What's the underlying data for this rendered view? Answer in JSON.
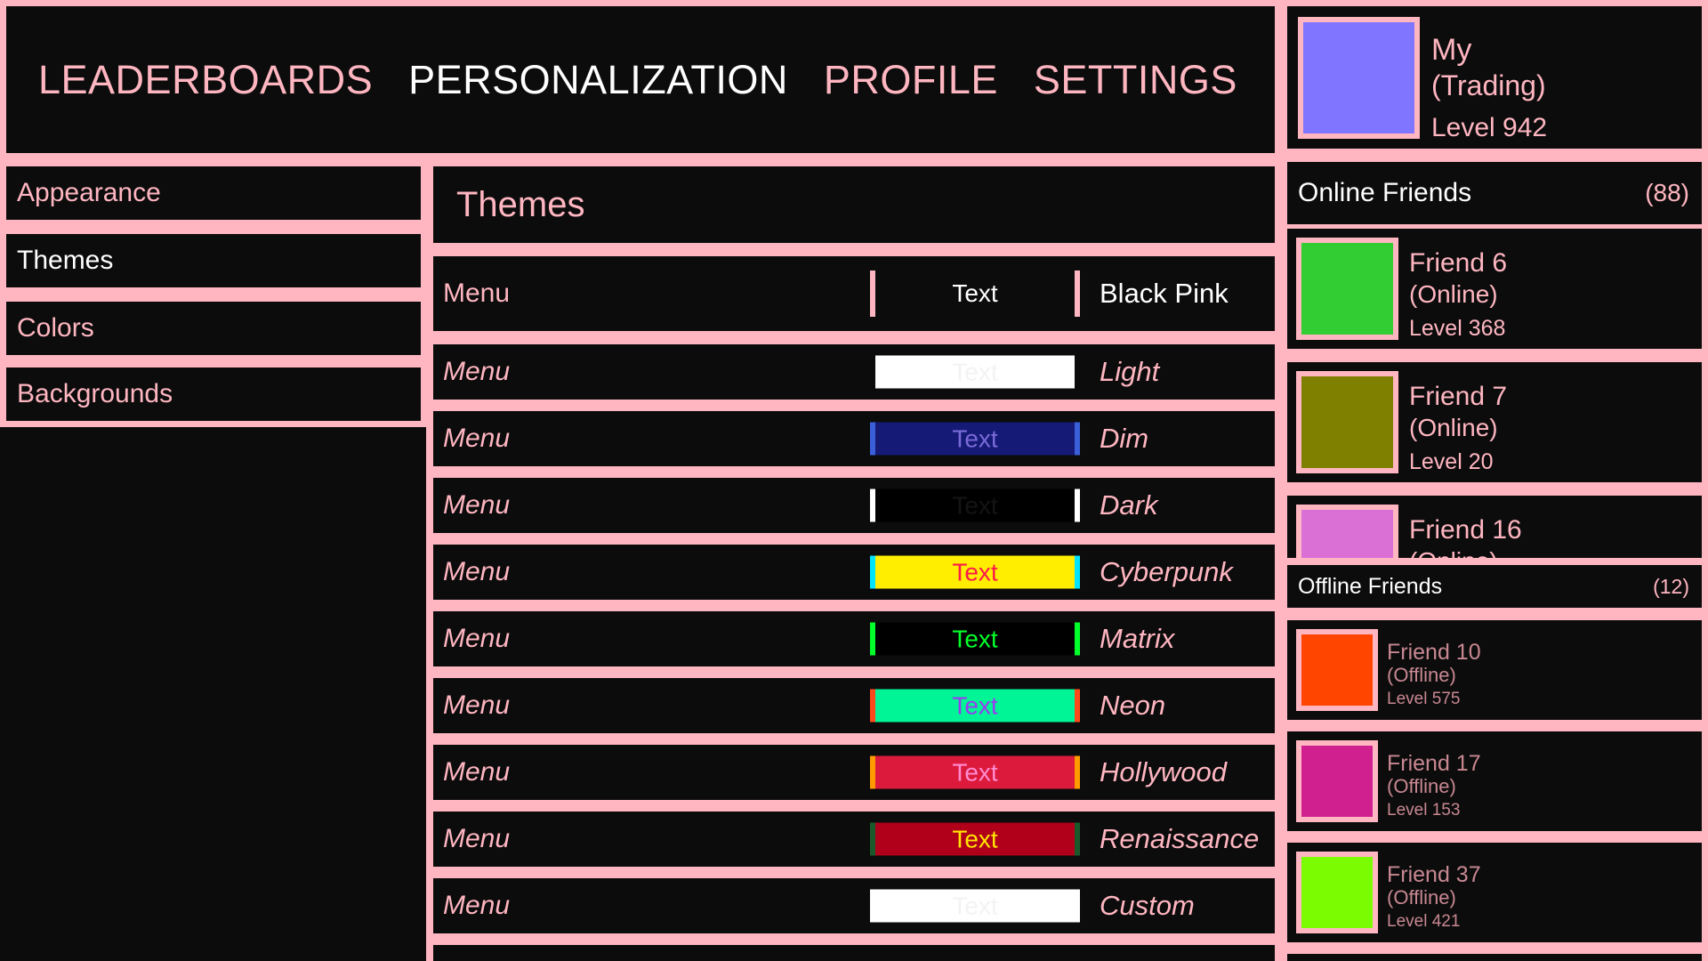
{
  "nav": {
    "tabs": [
      {
        "label": "LEADERBOARDS",
        "active": false
      },
      {
        "label": "PERSONALIZATION",
        "active": true
      },
      {
        "label": "PROFILE",
        "active": false
      },
      {
        "label": "SETTINGS",
        "active": false
      }
    ]
  },
  "profile": {
    "name": "My",
    "status": "(Trading)",
    "level": "Level 942",
    "avatar_color": "#8075ff"
  },
  "sidebar": {
    "items": [
      {
        "label": "Appearance",
        "active": false
      },
      {
        "label": "Themes",
        "active": true
      },
      {
        "label": "Colors",
        "active": false
      },
      {
        "label": "Backgrounds",
        "active": false
      }
    ]
  },
  "themes": {
    "title": "Themes",
    "rows": [
      {
        "menu": "Menu",
        "swatch_text": "Text",
        "name": "Black Pink",
        "bg": "#0c0c0c",
        "text_color": "#ffffff",
        "border": "#ffb6c1",
        "selected": true
      },
      {
        "menu": "Menu",
        "swatch_text": "Text",
        "name": "Light",
        "bg": "#ffffff",
        "text_color": "#f3f3f3",
        "border": "#0c0c0c",
        "selected": false
      },
      {
        "menu": "Menu",
        "swatch_text": "Text",
        "name": "Dim",
        "bg": "#151a76",
        "text_color": "#7a6ad8",
        "border": "#3a5fd8",
        "selected": false
      },
      {
        "menu": "Menu",
        "swatch_text": "Text",
        "name": "Dark",
        "bg": "#000000",
        "text_color": "#141414",
        "border": "#ffffff",
        "selected": false
      },
      {
        "menu": "Menu",
        "swatch_text": "Text",
        "name": "Cyberpunk",
        "bg": "#ffee00",
        "text_color": "#ff1a4a",
        "border": "#00e5ff",
        "selected": false
      },
      {
        "menu": "Menu",
        "swatch_text": "Text",
        "name": "Matrix",
        "bg": "#000000",
        "text_color": "#00ff2a",
        "border": "#00ff2a",
        "selected": false
      },
      {
        "menu": "Menu",
        "swatch_text": "Text",
        "name": "Neon",
        "bg": "#00f596",
        "text_color": "#9a3cf0",
        "border": "#ff4a1a",
        "selected": false
      },
      {
        "menu": "Menu",
        "swatch_text": "Text",
        "name": "Hollywood",
        "bg": "#dc1a3c",
        "text_color": "#ff8cd0",
        "border": "#ff9a00",
        "selected": false
      },
      {
        "menu": "Menu",
        "swatch_text": "Text",
        "name": "Renaissance",
        "bg": "#b0001a",
        "text_color": "#ffe500",
        "border": "#1a5a2a",
        "selected": false
      },
      {
        "menu": "Menu",
        "swatch_text": "Text",
        "name": "Custom",
        "bg": "#ffffff",
        "text_color": "#f3f3f3",
        "border": "#ffffff",
        "selected": false
      }
    ]
  },
  "online": {
    "title": "Online Friends",
    "count": "(88)",
    "friends": [
      {
        "name": "Friend 6",
        "status": "(Online)",
        "level": "Level 368",
        "color": "#32cd32"
      },
      {
        "name": "Friend 7",
        "status": "(Online)",
        "level": "Level 20",
        "color": "#808000"
      },
      {
        "name": "Friend 16",
        "status": "(Online)",
        "level": "",
        "color": "#da70d6"
      }
    ]
  },
  "offline": {
    "title": "Offline Friends",
    "count": "(12)",
    "friends": [
      {
        "name": "Friend 10",
        "status": "(Offline)",
        "level": "Level 575",
        "color": "#ff4500"
      },
      {
        "name": "Friend 17",
        "status": "(Offline)",
        "level": "Level 153",
        "color": "#d02090"
      },
      {
        "name": "Friend 37",
        "status": "(Offline)",
        "level": "Level 421",
        "color": "#7cfc00"
      }
    ]
  }
}
